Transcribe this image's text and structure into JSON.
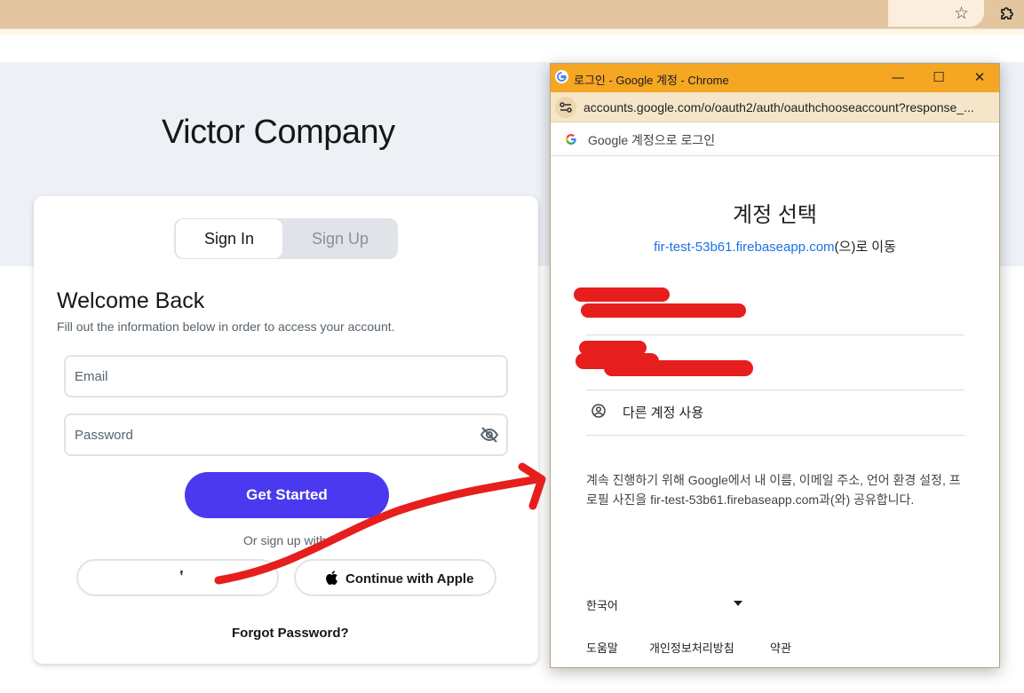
{
  "browser": {
    "star_icon": "star-icon",
    "extensions_icon": "puzzle-icon"
  },
  "page": {
    "brand": "Victor Company",
    "tabs": {
      "sign_in": "Sign In",
      "sign_up": "Sign Up"
    },
    "welcome": "Welcome Back",
    "subtitle": "Fill out the information below in order to access your account.",
    "email_placeholder": "Email",
    "password_placeholder": "Password",
    "primary_button": "Get Started",
    "or_sign_up": "Or sign up with",
    "google_button_spinner": "ʽ",
    "apple_button": "Continue with Apple",
    "forgot": "Forgot Password?"
  },
  "popup": {
    "window_title": "로그인 - Google 계정 - Chrome",
    "controls": {
      "minimize": "—",
      "maximize": "☐",
      "close": "✕"
    },
    "url": "accounts.google.com/o/oauth2/auth/oauthchooseaccount?response_...",
    "google_header": "Google 계정으로 로그인",
    "choose_heading": "계정 선택",
    "continue_to_link": "fir-test-53b61.firebaseapp.com",
    "continue_to_suffix": "(으)로 이동",
    "use_other_account": "다른 계정 사용",
    "info_text": "계속 진행하기 위해 Google에서 내 이름, 이메일 주소, 언어 환경 설정, 프로필 사진을 fir-test-53b61.firebaseapp.com과(와) 공유합니다.",
    "language": "한국어",
    "footer": {
      "help": "도움말",
      "privacy": "개인정보처리방침",
      "terms": "약관"
    }
  },
  "colors": {
    "primary": "#4b39ef",
    "popup_titlebar": "#f5a623",
    "link": "#1a73e8",
    "annotation": "#e61e1e"
  }
}
